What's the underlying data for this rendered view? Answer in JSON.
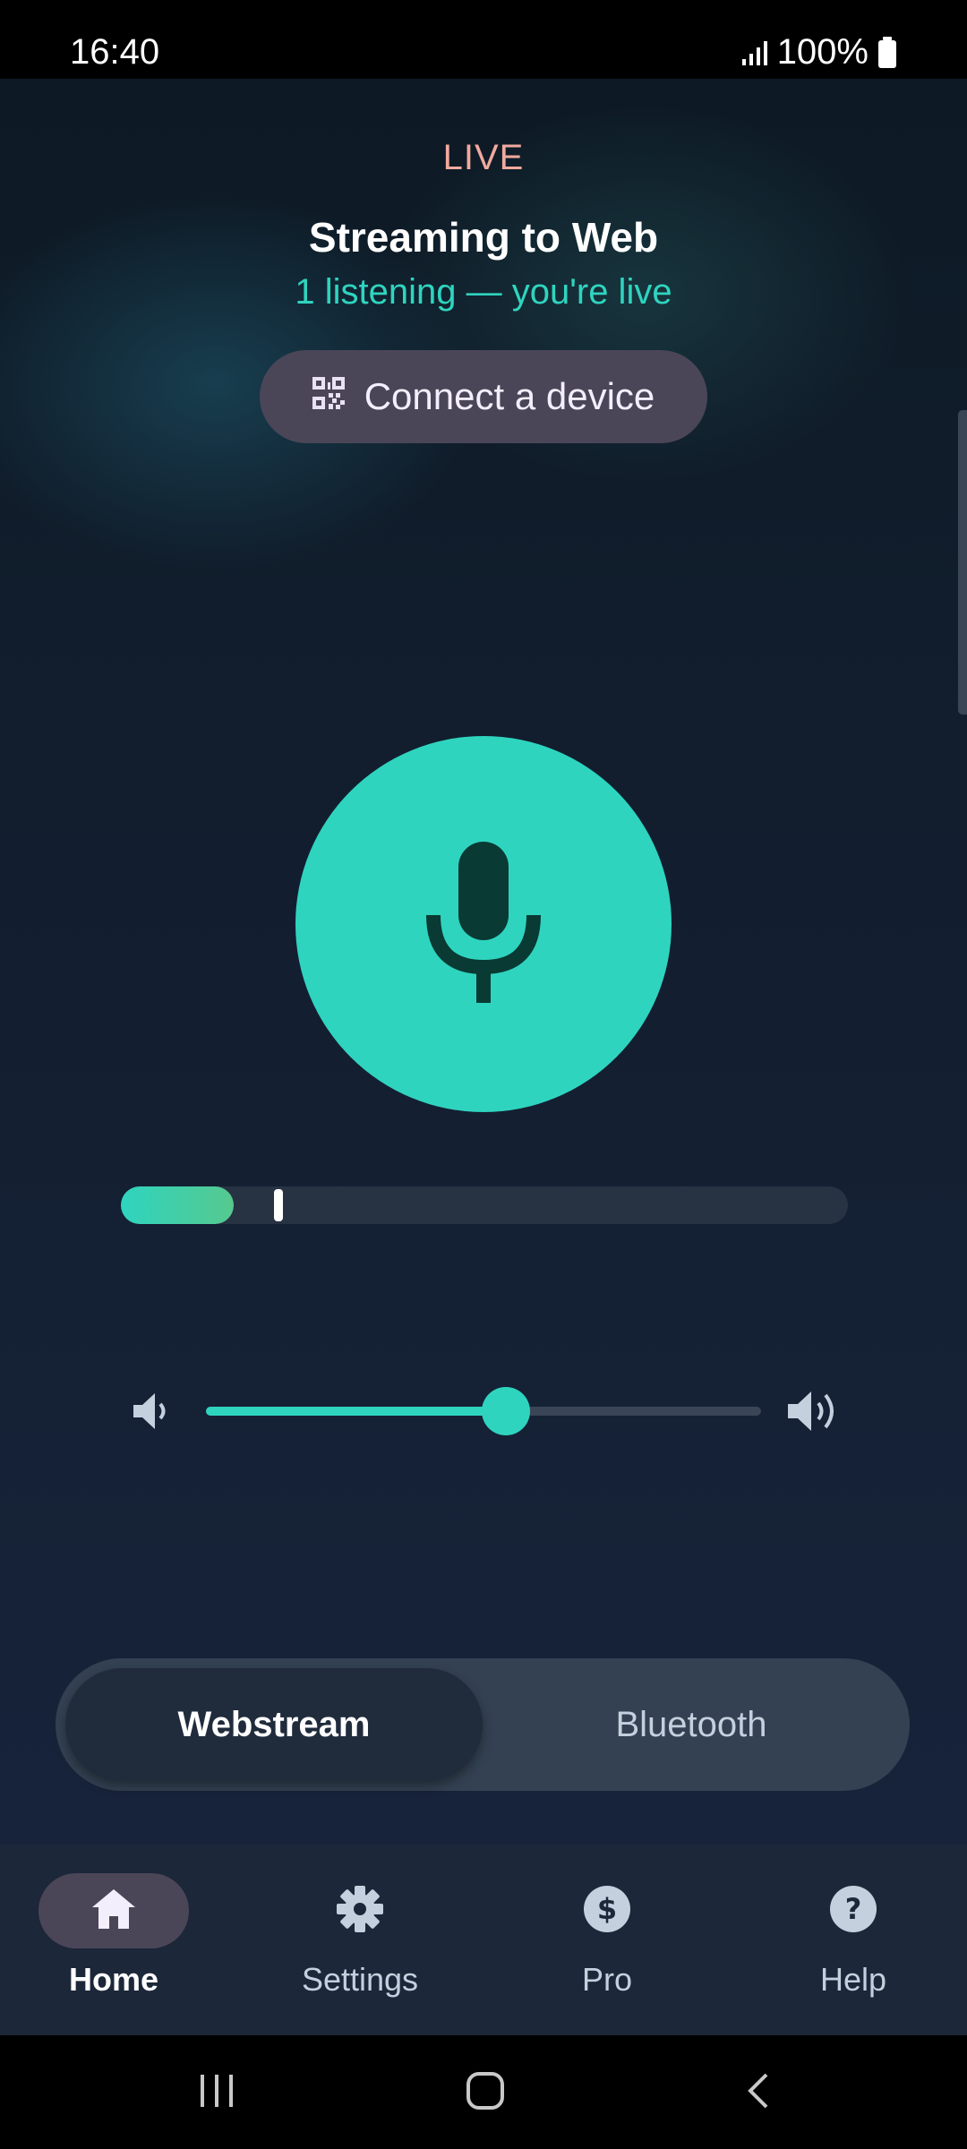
{
  "status_bar": {
    "time": "16:40",
    "battery_percent": "100%",
    "signal_icon": "signal-icon",
    "battery_icon": "battery-icon"
  },
  "stream": {
    "live_label": "LIVE",
    "title": "Streaming to Web",
    "subtitle": "1 listening — you're live",
    "connect_button": {
      "label": "Connect a device",
      "icon": "qr-code-icon"
    }
  },
  "mic": {
    "icon": "microphone-icon",
    "state": "on"
  },
  "level_meter": {
    "level": 0.155,
    "peak": 0.21
  },
  "volume": {
    "value": 0.54,
    "down_icon": "volume-down-icon",
    "up_icon": "volume-up-icon"
  },
  "mode_toggle": {
    "options": [
      "Webstream",
      "Bluetooth"
    ],
    "selected": "Webstream"
  },
  "bottom_nav": {
    "items": [
      {
        "label": "Home",
        "icon": "home-icon",
        "active": true
      },
      {
        "label": "Settings",
        "icon": "gear-icon",
        "active": false
      },
      {
        "label": "Pro",
        "icon": "dollar-icon",
        "active": false
      },
      {
        "label": "Help",
        "icon": "help-icon",
        "active": false
      }
    ]
  },
  "colors": {
    "accent": "#2fd4bf",
    "live": "#f2a99f",
    "chip": "#4a4658",
    "background": "#121e2e"
  }
}
